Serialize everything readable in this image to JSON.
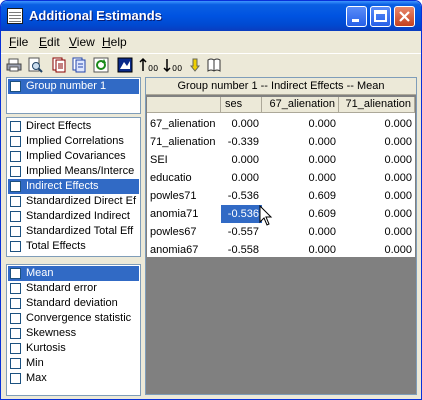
{
  "window": {
    "title": "Additional Estimands"
  },
  "menu": [
    "File",
    "Edit",
    "View",
    "Help"
  ],
  "toolbar": {
    "buttons": [
      "print-icon",
      "print-preview-icon",
      "copy-icon",
      "copy-table-icon",
      "refresh-icon",
      "export-icon",
      "decimals-increase-icon",
      "decimals-decrease-icon",
      "tip-icon",
      "help-book-icon"
    ]
  },
  "groups": [
    {
      "label": "Group number 1",
      "selected": true
    }
  ],
  "estimands": [
    {
      "label": "Direct Effects",
      "selected": false
    },
    {
      "label": "Implied Correlations",
      "selected": false
    },
    {
      "label": "Implied Covariances",
      "selected": false
    },
    {
      "label": "Implied Means/Interce",
      "selected": false
    },
    {
      "label": "Indirect Effects",
      "selected": true
    },
    {
      "label": "Standardized Direct Ef",
      "selected": false
    },
    {
      "label": "Standardized Indirect",
      "selected": false
    },
    {
      "label": "Standardized Total Eff",
      "selected": false
    },
    {
      "label": "Total Effects",
      "selected": false
    }
  ],
  "statistics": [
    {
      "label": "Mean",
      "selected": true
    },
    {
      "label": "Standard error",
      "selected": false
    },
    {
      "label": "Standard deviation",
      "selected": false
    },
    {
      "label": "Convergence statistic",
      "selected": false
    },
    {
      "label": "Skewness",
      "selected": false
    },
    {
      "label": "Kurtosis",
      "selected": false
    },
    {
      "label": "Min",
      "selected": false
    },
    {
      "label": "Max",
      "selected": false
    }
  ],
  "table": {
    "title": "Group number 1 -- Indirect Effects -- Mean",
    "columns": [
      "ses",
      "67_alienation",
      "71_alienation"
    ],
    "rows": [
      {
        "label": "67_alienation",
        "values": [
          "0.000",
          "0.000",
          "0.000"
        ]
      },
      {
        "label": "71_alienation",
        "values": [
          "-0.339",
          "0.000",
          "0.000"
        ]
      },
      {
        "label": "SEI",
        "values": [
          "0.000",
          "0.000",
          "0.000"
        ]
      },
      {
        "label": "educatio",
        "values": [
          "0.000",
          "0.000",
          "0.000"
        ]
      },
      {
        "label": "powles71",
        "values": [
          "-0.536",
          "0.609",
          "0.000"
        ]
      },
      {
        "label": "anomia71",
        "values": [
          "-0.536",
          "0.609",
          "0.000"
        ]
      },
      {
        "label": "powles67",
        "values": [
          "-0.557",
          "0.000",
          "0.000"
        ]
      },
      {
        "label": "anomia67",
        "values": [
          "-0.558",
          "0.000",
          "0.000"
        ]
      }
    ],
    "selected_cell": {
      "row": 5,
      "col": 0
    }
  },
  "colors": {
    "selection": "#316ac5",
    "titlebar": "#0053e1",
    "panel_bg": "#808080"
  }
}
